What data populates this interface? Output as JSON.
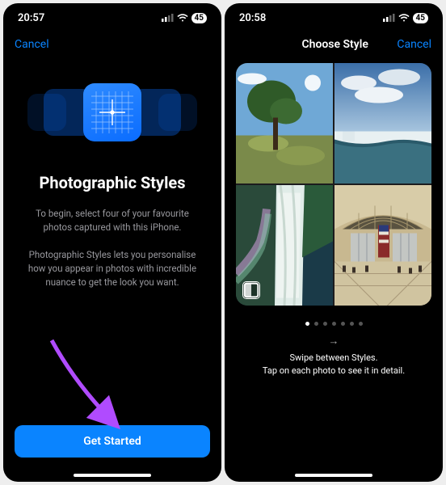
{
  "screen1": {
    "status": {
      "time": "20:57",
      "battery": "45"
    },
    "nav": {
      "cancel": "Cancel"
    },
    "heading": "Photographic Styles",
    "paragraph1": "To begin, select four of your favourite photos captured with this iPhone.",
    "paragraph2": "Photographic Styles lets you personalise how you appear in photos with incredible nuance to get the look you want.",
    "cta": "Get Started"
  },
  "screen2": {
    "status": {
      "time": "20:58",
      "battery": "45"
    },
    "nav": {
      "title": "Choose Style",
      "cancel": "Cancel"
    },
    "hint_line1": "Swipe between Styles.",
    "hint_line2": "Tap on each photo to see it in detail.",
    "page_dots": 7,
    "active_dot": 1
  }
}
